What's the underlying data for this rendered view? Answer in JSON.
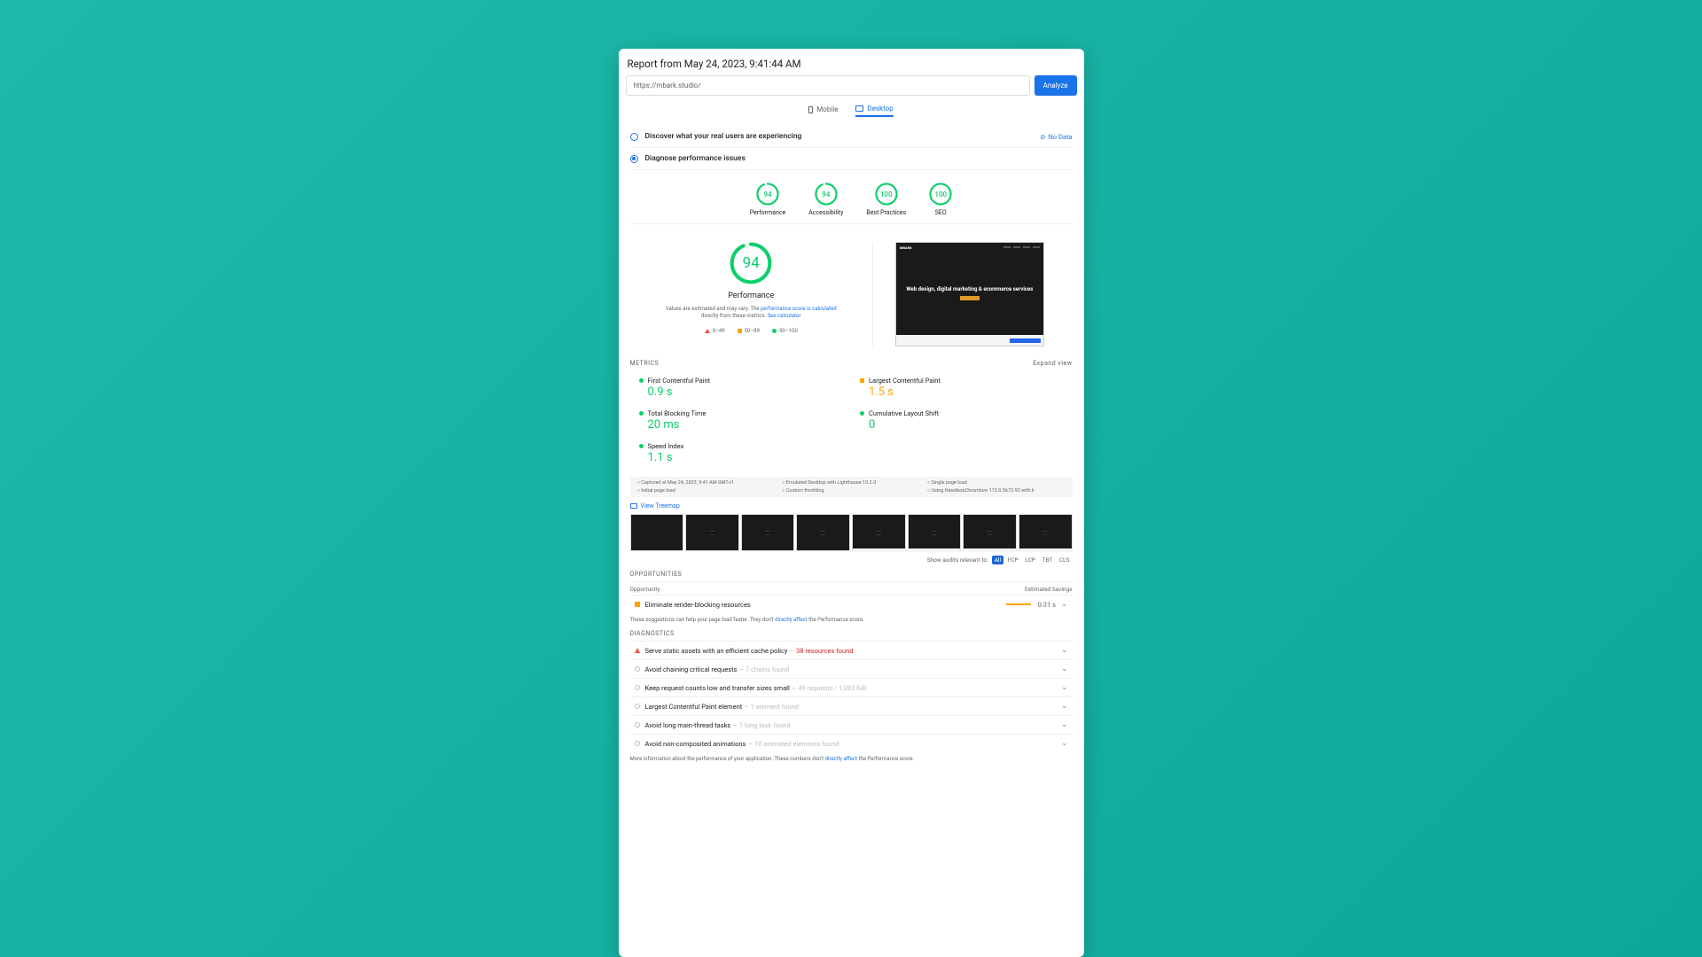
{
  "title": "Report from May 24, 2023, 9:41:44 AM",
  "url": "https://mbark.studio/",
  "analyze": "Analyze",
  "tabs": {
    "mobile": "Mobile",
    "desktop": "Desktop"
  },
  "discover": "Discover what your real users are experiencing",
  "nodata": "No Data",
  "diagnose": "Diagnose performance issues",
  "gauges": [
    {
      "score": "94",
      "label": "Performance",
      "arc": 94
    },
    {
      "score": "94",
      "label": "Accessibility",
      "arc": 94
    },
    {
      "score": "100",
      "label": "Best Practices",
      "arc": 100
    },
    {
      "score": "100",
      "label": "SEO",
      "arc": 100
    }
  ],
  "big": {
    "score": "94",
    "label": "Performance",
    "arc": 94
  },
  "disclaim1": "Values are estimated and may vary. The ",
  "disclaim_link1": "performance score is calculated",
  "disclaim2": " directly from these metrics. ",
  "disclaim_link2": "See calculator",
  "legend": {
    "r": "0–49",
    "o": "50–89",
    "g": "90–100"
  },
  "screenshot": {
    "logo": "MBARK",
    "headline": "Web design, digital marketing & ecommerce services"
  },
  "met_hdr": "METRICS",
  "expand": "Expand view",
  "metrics": [
    {
      "name": "First Contentful Paint",
      "val": "0.9 s",
      "cls": "g"
    },
    {
      "name": "Largest Contentful Paint",
      "val": "1.5 s",
      "cls": "o"
    },
    {
      "name": "Total Blocking Time",
      "val": "20 ms",
      "cls": "g"
    },
    {
      "name": "Cumulative Layout Shift",
      "val": "0",
      "cls": "g"
    },
    {
      "name": "Speed Index",
      "val": "1.1 s",
      "cls": "g"
    }
  ],
  "env": [
    "Captured at May 24, 2023, 9:41 AM GMT+1",
    "Emulated Desktop with Lighthouse 10.2.0",
    "Single page load",
    "Initial page load",
    "Custom throttling",
    "Using HeadlessChromium 113.0.5672.92 with lr"
  ],
  "treemap": "View Treemap",
  "filter_lbl": "Show audits relevant to:",
  "filter": [
    "All",
    "FCP",
    "LCP",
    "TBT",
    "CLS"
  ],
  "opp_lbl": "OPPORTUNITIES",
  "opp_hdr": {
    "l": "Opportunity",
    "r": "Estimated Savings"
  },
  "opps": [
    {
      "shape": "sq",
      "text": "Eliminate render-blocking resources",
      "sav": "0.31 s"
    }
  ],
  "opp_note1": "These suggestions can help your page load faster. They don't ",
  "opp_note_link": "directly affect",
  "opp_note2": " the Performance score.",
  "diag_lbl": "DIAGNOSTICS",
  "diags": [
    {
      "shape": "tri",
      "text": "Serve static assets with an efficient cache policy",
      "sub": " — ",
      "red": "38 resources found"
    },
    {
      "shape": "ci",
      "text": "Avoid chaining critical requests",
      "sub": " — 7 chains found"
    },
    {
      "shape": "ci",
      "text": "Keep request counts low and transfer sizes small",
      "sub": " — 49 requests • 1,083 KiB"
    },
    {
      "shape": "ci",
      "text": "Largest Contentful Paint element",
      "sub": " — 1 element found"
    },
    {
      "shape": "ci",
      "text": "Avoid long main-thread tasks",
      "sub": " — 1 long task found"
    },
    {
      "shape": "ci",
      "text": "Avoid non-composited animations",
      "sub": " — 10 animated elements found"
    }
  ],
  "diag_note1": "More information about the performance of your application. These numbers don't ",
  "diag_note_link": "directly affect",
  "diag_note2": " the Performance score."
}
